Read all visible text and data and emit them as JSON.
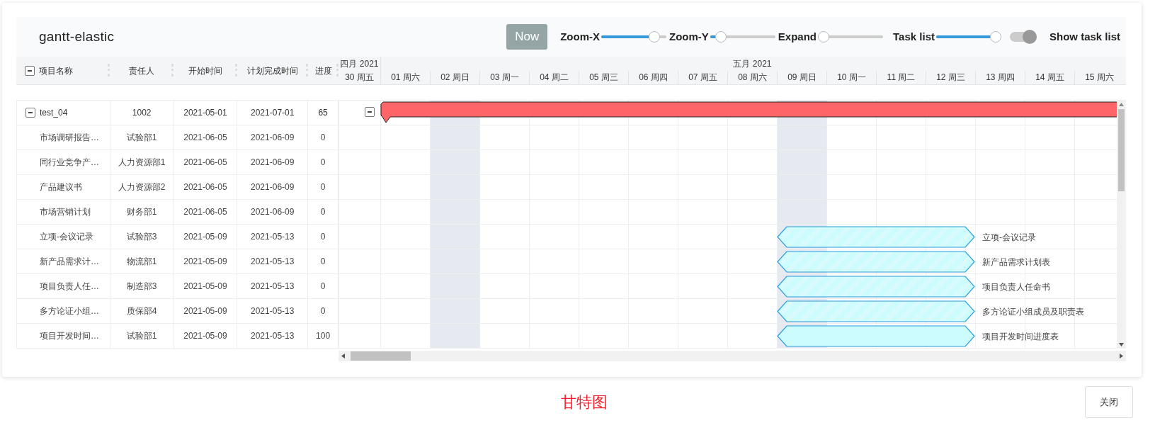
{
  "header": {
    "title": "gantt-elastic",
    "now_button": "Now",
    "sliders": [
      {
        "label": "Zoom-X",
        "level": 0.88
      },
      {
        "label": "Zoom-Y",
        "level": 0.1
      },
      {
        "label": "Expand",
        "level": 0
      },
      {
        "label": "Task list",
        "level": 1
      }
    ],
    "toggle": {
      "label": "Show task list",
      "checked": true
    }
  },
  "columns": [
    {
      "label": "项目名称",
      "expanded": true
    },
    {
      "label": "责任人"
    },
    {
      "label": "开始时间"
    },
    {
      "label": "计划完成时间"
    },
    {
      "label": "进度"
    }
  ],
  "timeline": {
    "months": [
      {
        "label": "四月 2021",
        "days": [
          {
            "label": "30 周五",
            "shaded": false
          }
        ]
      },
      {
        "label": "五月 2021",
        "days": [
          {
            "label": "01 周六",
            "shaded": false
          },
          {
            "label": "02 周日",
            "shaded": true
          },
          {
            "label": "03 周一",
            "shaded": false
          },
          {
            "label": "04 周二",
            "shaded": false
          },
          {
            "label": "05 周三",
            "shaded": false
          },
          {
            "label": "06 周四",
            "shaded": false
          },
          {
            "label": "07 周五",
            "shaded": false
          },
          {
            "label": "08 周六",
            "shaded": false
          },
          {
            "label": "09 周日",
            "shaded": true
          },
          {
            "label": "10 周一",
            "shaded": false
          },
          {
            "label": "11 周二",
            "shaded": false
          },
          {
            "label": "12 周三",
            "shaded": false
          },
          {
            "label": "13 周四",
            "shaded": false
          },
          {
            "label": "14 周五",
            "shaded": false
          },
          {
            "label": "15 周六",
            "shaded": false
          }
        ]
      }
    ]
  },
  "tasks": [
    {
      "kind": "project",
      "name": "test_04",
      "owner": "1002",
      "start": "2021-05-01",
      "end": "2021-07-01",
      "progress": "65",
      "expanded": true,
      "children": [
        {
          "kind": "task",
          "name": "市场调研报告…",
          "owner": "试验部1",
          "start": "2021-06-05",
          "end": "2021-06-09",
          "progress": "0"
        },
        {
          "kind": "task",
          "name": "同行业竞争产…",
          "owner": "人力资源部1",
          "start": "2021-06-05",
          "end": "2021-06-09",
          "progress": "0"
        },
        {
          "kind": "task",
          "name": "产品建议书",
          "owner": "人力资源部2",
          "start": "2021-06-05",
          "end": "2021-06-09",
          "progress": "0"
        },
        {
          "kind": "task",
          "name": "市场营销计划",
          "owner": "财务部1",
          "start": "2021-06-05",
          "end": "2021-06-09",
          "progress": "0"
        },
        {
          "kind": "task",
          "name": "立项-会议记录",
          "owner": "试验部3",
          "start": "2021-05-09",
          "end": "2021-05-13",
          "progress": "0",
          "bar_label": "立项-会议记录"
        },
        {
          "kind": "task",
          "name": "新产品需求计…",
          "owner": "物流部1",
          "start": "2021-05-09",
          "end": "2021-05-13",
          "progress": "0",
          "bar_label": "新产品需求计划表"
        },
        {
          "kind": "task",
          "name": "项目负责人任…",
          "owner": "制造部3",
          "start": "2021-05-09",
          "end": "2021-05-13",
          "progress": "0",
          "bar_label": "项目负责人任命书"
        },
        {
          "kind": "task",
          "name": "多方论证小组…",
          "owner": "质保部4",
          "start": "2021-05-09",
          "end": "2021-05-13",
          "progress": "0",
          "bar_label": "多方论证小组成员及职责表"
        },
        {
          "kind": "task",
          "name": "项目开发时间…",
          "owner": "试验部1",
          "start": "2021-05-09",
          "end": "2021-05-13",
          "progress": "100",
          "bar_label": "项目开发时间进度表"
        }
      ]
    }
  ],
  "caption": "甘特图",
  "close_button": "关闭"
}
